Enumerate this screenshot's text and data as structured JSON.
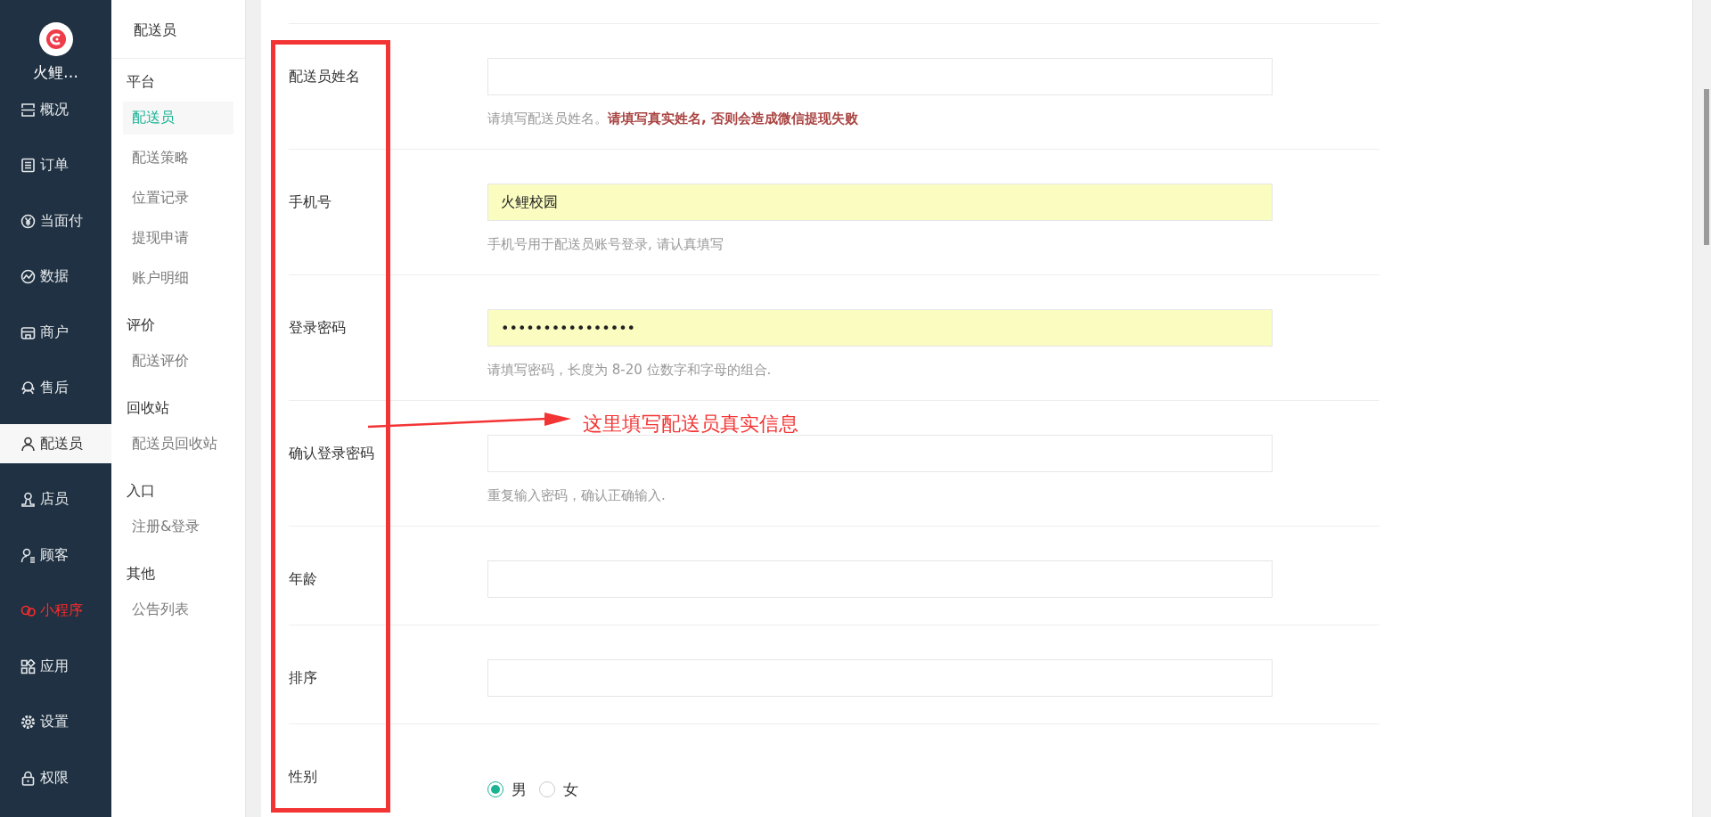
{
  "app": {
    "name": "火鲤…"
  },
  "nav": [
    {
      "label": "概况",
      "selected": false,
      "highlighted": false
    },
    {
      "label": "订单",
      "selected": false,
      "highlighted": false
    },
    {
      "label": "当面付",
      "selected": false,
      "highlighted": false
    },
    {
      "label": "数据",
      "selected": false,
      "highlighted": false
    },
    {
      "label": "商户",
      "selected": false,
      "highlighted": false
    },
    {
      "label": "售后",
      "selected": false,
      "highlighted": false
    },
    {
      "label": "配送员",
      "selected": true,
      "highlighted": false
    },
    {
      "label": "店员",
      "selected": false,
      "highlighted": false
    },
    {
      "label": "顾客",
      "selected": false,
      "highlighted": false
    },
    {
      "label": "小程序",
      "selected": false,
      "highlighted": true
    },
    {
      "label": "应用",
      "selected": false,
      "highlighted": false
    },
    {
      "label": "设置",
      "selected": false,
      "highlighted": false
    },
    {
      "label": "权限",
      "selected": false,
      "highlighted": false
    }
  ],
  "subnav": {
    "title": "配送员",
    "groups": [
      {
        "label": "平台",
        "items": [
          {
            "label": "配送员",
            "selected": true
          },
          {
            "label": "配送策略",
            "selected": false
          },
          {
            "label": "位置记录",
            "selected": false
          },
          {
            "label": "提现申请",
            "selected": false
          },
          {
            "label": "账户明细",
            "selected": false
          }
        ]
      },
      {
        "label": "评价",
        "items": [
          {
            "label": "配送评价",
            "selected": false
          }
        ]
      },
      {
        "label": "回收站",
        "items": [
          {
            "label": "配送员回收站",
            "selected": false
          }
        ]
      },
      {
        "label": "入口",
        "items": [
          {
            "label": "注册&登录",
            "selected": false
          }
        ]
      },
      {
        "label": "其他",
        "items": [
          {
            "label": "公告列表",
            "selected": false
          }
        ]
      }
    ]
  },
  "form": [
    {
      "kind": "text",
      "label": "配送员姓名",
      "hint": "请填写配送员姓名。**请填写真实姓名, 否则会造成微信提现失败**"
    },
    {
      "kind": "text",
      "label": "手机号",
      "value": "火鲤校园",
      "autofilled": true,
      "hint": "手机号用于配送员账号登录, 请认真填写"
    },
    {
      "kind": "password",
      "label": "登录密码",
      "value": "••••••••••••••••",
      "autofilled": true,
      "hint": "请填写密码，长度为 8-20 位数字和字母的组合."
    },
    {
      "kind": "text",
      "label": "确认登录密码",
      "hint": "重复输入密码，确认正确输入."
    },
    {
      "kind": "text",
      "label": "年龄"
    },
    {
      "kind": "text",
      "label": "排序"
    },
    {
      "kind": "radio",
      "label": "性别",
      "options": [
        {
          "label": "男",
          "selected": true
        },
        {
          "label": "女",
          "selected": false
        }
      ]
    }
  ],
  "annotation": {
    "text": "这里填写配送员真实信息"
  }
}
